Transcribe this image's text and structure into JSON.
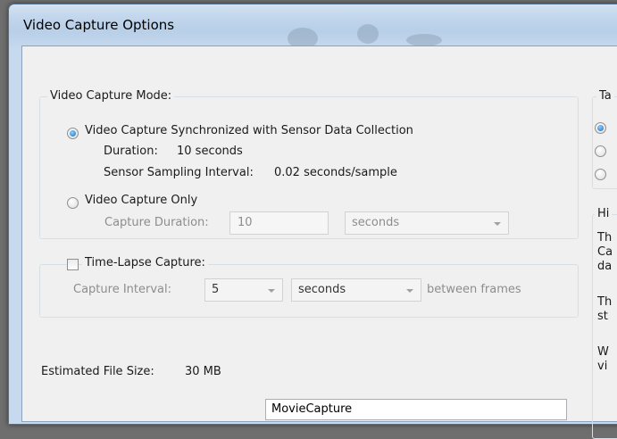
{
  "window": {
    "title": "Video Capture Options"
  },
  "capture_mode": {
    "legend": "Video Capture Mode:",
    "synchronized": {
      "label": "Video Capture Synchronized with Sensor Data Collection",
      "duration_label": "Duration:",
      "duration_value": "10 seconds",
      "interval_label": "Sensor Sampling Interval:",
      "interval_value": "0.02 seconds/sample"
    },
    "only": {
      "label": "Video Capture Only",
      "duration_label": "Capture Duration:",
      "duration_value": "10",
      "unit_value": "seconds"
    }
  },
  "time_lapse": {
    "label": "Time-Lapse Capture:",
    "interval_label": "Capture Interval:",
    "interval_value": "5",
    "unit_value": "seconds",
    "suffix": "between frames"
  },
  "file_size": {
    "label": "Estimated File Size:",
    "value": "30 MB"
  },
  "file_name": {
    "value": "MovieCapture"
  },
  "right_group": {
    "legend": "Ta"
  },
  "hint_group": {
    "legend": "Hi",
    "lines": [
      "Th",
      "Ca",
      "da",
      "Th",
      "st",
      "W",
      "vi"
    ]
  },
  "colors": {
    "accent": "#1b69b8",
    "titlebar": "#c2d6ec",
    "dialog_background": "#f0f0f0",
    "disabled_text": "#8d8d8d"
  },
  "icons": {
    "radio_selected": "radio-selected-icon",
    "radio_unselected": "radio-unselected-icon",
    "checkbox_unchecked": "checkbox-unchecked-icon",
    "dropdown": "chevron-down-icon"
  }
}
